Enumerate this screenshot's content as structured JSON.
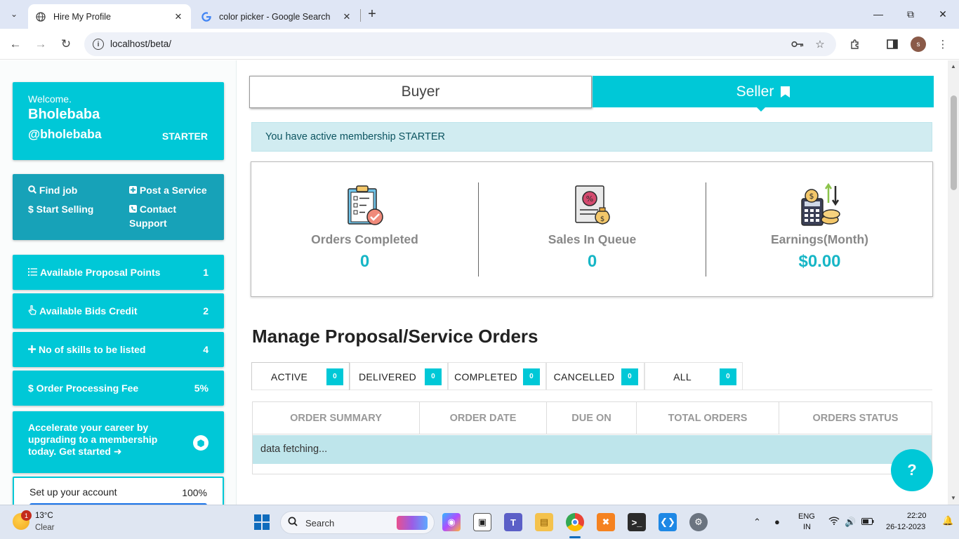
{
  "browser": {
    "tabs": [
      {
        "title": "Hire My Profile",
        "active": true
      },
      {
        "title": "color picker - Google Search",
        "active": false
      }
    ],
    "url": "localhost/beta/",
    "profile_initial": "s"
  },
  "sidebar": {
    "welcome": {
      "label": "Welcome.",
      "name": "Bholebaba",
      "handle": "@bholebaba",
      "plan": "STARTER"
    },
    "links": {
      "find_job": "Find job",
      "post_service": "Post a Service",
      "start_selling": "$ Start Selling",
      "contact_support_1": "Contact",
      "contact_support_2": "Support"
    },
    "stats": [
      {
        "label": "Available Proposal Points",
        "value": "1",
        "icon": "list-icon"
      },
      {
        "label": "Available Bids Credit",
        "value": "2",
        "icon": "hand-pointer-icon"
      },
      {
        "label": "No of skills to be listed",
        "value": "4",
        "icon": "plus-icon"
      },
      {
        "label": "$ Order Processing Fee",
        "value": "5%",
        "icon": "dollar-icon"
      }
    ],
    "upgrade": {
      "line1": "Accelerate your career by",
      "line2": "upgrading to a membership",
      "line3": "today. Get started"
    },
    "setup": {
      "label": "Set up your account",
      "value": "100%",
      "progress_fraction": 1.0
    }
  },
  "main": {
    "segment": {
      "buyer": "Buyer",
      "seller": "Seller",
      "active": "Seller"
    },
    "alert": "You have active membership STARTER",
    "stats": [
      {
        "label": "Orders Completed",
        "value": "0",
        "icon": "clipboard-check-icon"
      },
      {
        "label": "Sales In Queue",
        "value": "0",
        "icon": "invoice-moneybag-icon"
      },
      {
        "label": "Earnings(Month)",
        "value": "$0.00",
        "icon": "calculator-coins-icon"
      }
    ],
    "section_title": "Manage Proposal/Service Orders",
    "order_tabs": [
      {
        "label": "ACTIVE",
        "count": "0",
        "active": true
      },
      {
        "label": "DELIVERED",
        "count": "0",
        "active": false
      },
      {
        "label": "COMPLETED",
        "count": "0",
        "active": false
      },
      {
        "label": "CANCELLED",
        "count": "0",
        "active": false
      },
      {
        "label": "ALL",
        "count": "0",
        "active": false
      }
    ],
    "table": {
      "headers": [
        "ORDER SUMMARY",
        "ORDER DATE",
        "DUE ON",
        "TOTAL ORDERS",
        "ORDERS STATUS"
      ],
      "status_row": "data fetching..."
    },
    "help_label": "?"
  },
  "colors": {
    "accent": "#00c8d7",
    "links_bg": "#17a2b8",
    "alert_bg": "#d1ecf1",
    "stat_value": "#17b6c6"
  },
  "taskbar": {
    "weather": {
      "temp": "13°C",
      "desc": "Clear",
      "badge": "1"
    },
    "search_placeholder": "Search",
    "language": {
      "line1": "ENG",
      "line2": "IN"
    },
    "clock": {
      "time": "22:20",
      "date": "26-12-2023"
    }
  }
}
